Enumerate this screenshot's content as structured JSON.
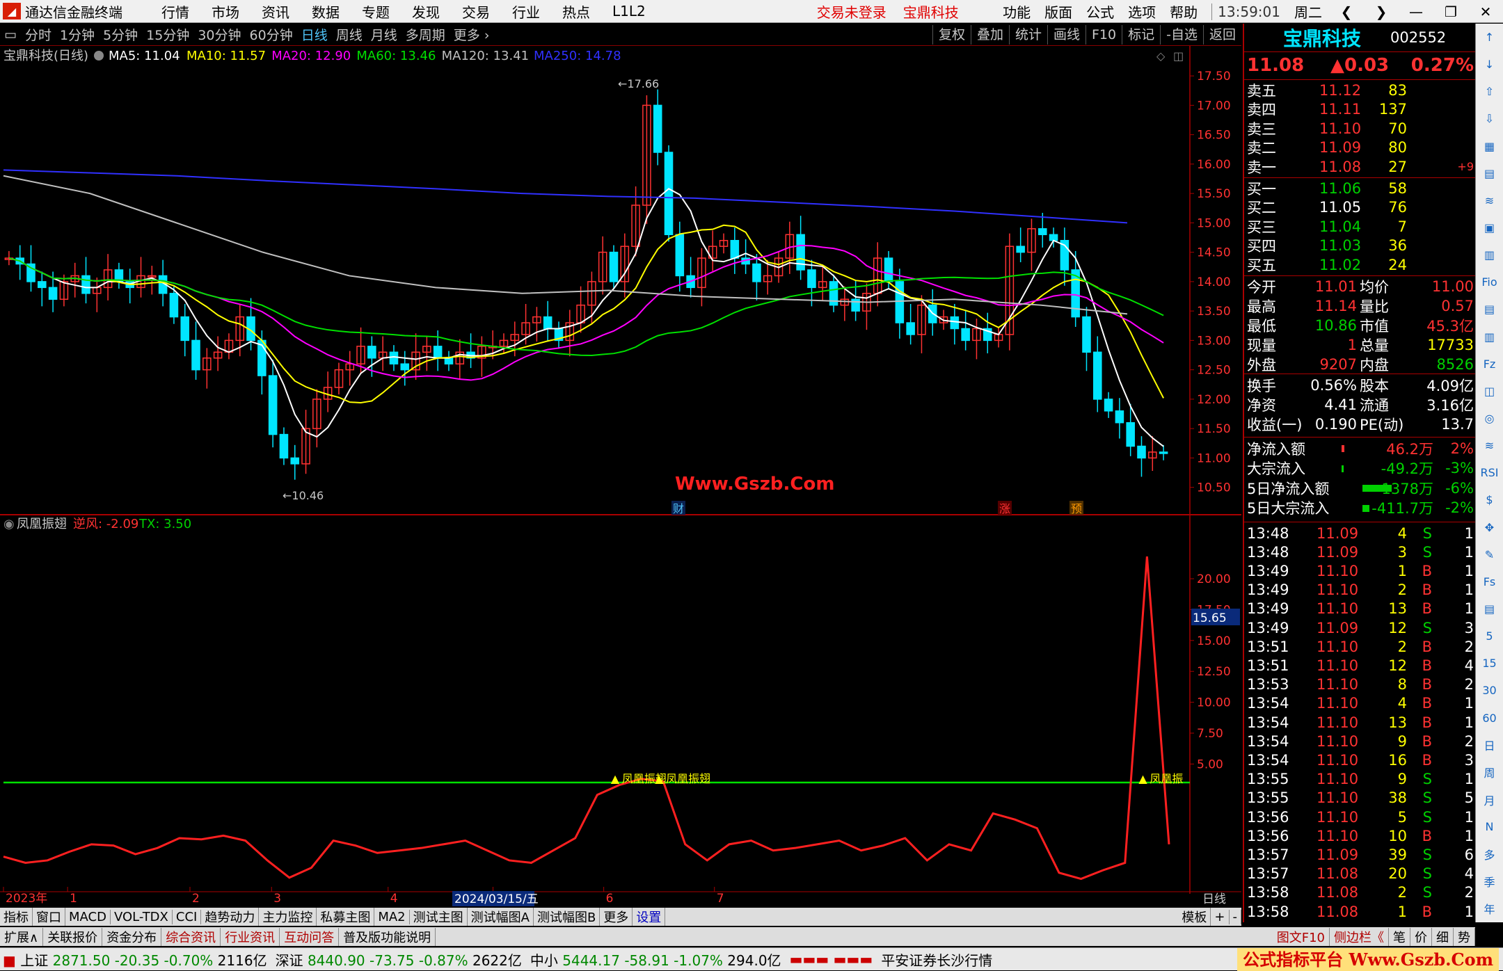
{
  "app": {
    "title": "通达信金融终端",
    "menu": [
      "行情",
      "市场",
      "资讯",
      "数据",
      "专题",
      "发现",
      "交易",
      "行业",
      "热点",
      "L1L2"
    ],
    "trade_status": "交易未登录",
    "stock_link": "宝鼎科技",
    "right_menu": [
      "功能",
      "版面",
      "公式",
      "选项",
      "帮助"
    ],
    "clock": "13:59:01",
    "weekday": "周二"
  },
  "periods": [
    "分时",
    "1分钟",
    "5分钟",
    "15分钟",
    "30分钟",
    "60分钟",
    "日线",
    "周线",
    "月线",
    "多周期",
    "更多"
  ],
  "active_period": "日线",
  "tools": [
    "复权",
    "叠加",
    "统计",
    "画线",
    "F10",
    "标记",
    "-自选",
    "返回"
  ],
  "main_chart": {
    "title": "宝鼎科技(日线)",
    "ma_labels": [
      {
        "text": "MA5: 11.04",
        "color": "#ffffff"
      },
      {
        "text": "MA10: 11.57",
        "color": "#ffff00"
      },
      {
        "text": "MA20: 12.90",
        "color": "#ff00ff"
      },
      {
        "text": "MA60: 13.46",
        "color": "#00e000"
      },
      {
        "text": "MA120: 13.41",
        "color": "#c0c0c0"
      },
      {
        "text": "MA250: 14.78",
        "color": "#3030ff"
      }
    ],
    "y_ticks": [
      "17.50",
      "17.00",
      "16.50",
      "16.00",
      "15.50",
      "15.00",
      "14.50",
      "14.00",
      "13.50",
      "13.00",
      "12.50",
      "12.00",
      "11.50",
      "11.00",
      "10.50"
    ],
    "y_range": [
      10.2,
      17.75
    ],
    "high_label": "17.66",
    "low_label": "10.46",
    "watermark": "Www.Gszb.Com",
    "event_markers": [
      {
        "text": "财",
        "color": "#4fc3f7"
      },
      {
        "text": "涨",
        "color": "#ff3232"
      },
      {
        "text": "预",
        "color": "#ff9800"
      }
    ]
  },
  "indicator": {
    "name": "凤凰振翅",
    "label1": "逆风: -2.09",
    "label2": "TX: 3.50",
    "y_ticks": [
      "20.00",
      "17.50",
      "15.00",
      "12.50",
      "10.00",
      "7.50",
      "5.00"
    ],
    "y_range": [
      -5,
      24
    ],
    "current": "15.65",
    "signal_labels": [
      "凤凰振翅",
      "凤凰振翅",
      "凤凰振"
    ],
    "threshold": 3.5
  },
  "x_axis": {
    "labels": [
      "2023年",
      "1",
      "2",
      "3",
      "4",
      "5",
      "6",
      "7"
    ],
    "cursor_date": "2024/03/15/五",
    "period": "日线"
  },
  "bottom_tabs": [
    "指标",
    "窗口",
    "MACD",
    "VOL-TDX",
    "CCI",
    "趋势动力",
    "主力监控",
    "私募主图",
    "MA2",
    "测试主图",
    "测试幅图A",
    "测试幅图B",
    "更多",
    "设置"
  ],
  "bottom_tabs_right": [
    "模板",
    "+",
    "-"
  ],
  "bottom_tabs2": [
    "扩展∧",
    "关联报价",
    "资金分布",
    "综合资讯",
    "行业资讯",
    "互动问答",
    "普及版功能说明"
  ],
  "bottom_tabs2_right": [
    "图文F10",
    "侧边栏《",
    "笔",
    "价",
    "细",
    "势"
  ],
  "status": {
    "indices": [
      {
        "name": "上证",
        "value": "2871.50",
        "chg": "-20.35",
        "pct": "-0.70%",
        "amt": "2116亿"
      },
      {
        "name": "深证",
        "value": "8440.90",
        "chg": "-73.75",
        "pct": "-0.87%",
        "amt": "2622亿"
      },
      {
        "name": "中小",
        "value": "5444.17",
        "chg": "-58.91",
        "pct": "-1.07%",
        "amt": "294.0亿"
      }
    ],
    "broker": "平安证券长沙行情",
    "brand": "公式指标平台 Www.Gszb.Com"
  },
  "quote": {
    "name": "宝鼎科技",
    "code": "002552",
    "price": "11.08",
    "change": "▲0.03",
    "pct": "0.27%",
    "asks": [
      {
        "label": "卖五",
        "price": "11.12",
        "vol": "83"
      },
      {
        "label": "卖四",
        "price": "11.11",
        "vol": "137"
      },
      {
        "label": "卖三",
        "price": "11.10",
        "vol": "70"
      },
      {
        "label": "卖二",
        "price": "11.09",
        "vol": "80"
      },
      {
        "label": "卖一",
        "price": "11.08",
        "vol": "27",
        "extra": "+9"
      }
    ],
    "bids": [
      {
        "label": "买一",
        "price": "11.06",
        "vol": "58"
      },
      {
        "label": "买二",
        "price": "11.05",
        "vol": "76"
      },
      {
        "label": "买三",
        "price": "11.04",
        "vol": "7"
      },
      {
        "label": "买四",
        "price": "11.03",
        "vol": "36"
      },
      {
        "label": "买五",
        "price": "11.02",
        "vol": "24"
      }
    ],
    "stats": [
      {
        "k1": "今开",
        "v1": "11.01",
        "k2": "均价",
        "v2": "11.00"
      },
      {
        "k1": "最高",
        "v1": "11.14",
        "k2": "量比",
        "v2": "0.57"
      },
      {
        "k1": "最低",
        "v1": "10.86",
        "k2": "市值",
        "v2": "45.3亿"
      },
      {
        "k1": "现量",
        "v1": "1",
        "k2": "总量",
        "v2": "17733"
      },
      {
        "k1": "外盘",
        "v1": "9207",
        "k2": "内盘",
        "v2": "8526"
      }
    ],
    "stats2": [
      {
        "k1": "换手",
        "v1": "0.56%",
        "k2": "股本",
        "v2": "4.09亿"
      },
      {
        "k1": "净资",
        "v1": "4.41",
        "k2": "流通",
        "v2": "3.16亿"
      },
      {
        "k1": "收益(一)",
        "v1": "0.190",
        "k2": "PE(动)",
        "v2": "13.7"
      }
    ],
    "flows": [
      {
        "k": "净流入额",
        "v": "46.2万",
        "p": "2%",
        "bar": 2
      },
      {
        "k": "大宗流入",
        "v": "-49.2万",
        "p": "-3%",
        "bar": 1
      },
      {
        "k": "5日净流入额",
        "v": "-1378万",
        "p": "-6%",
        "bar": 50
      },
      {
        "k": "5日大宗流入",
        "v": "-411.7万",
        "p": "-2%",
        "bar": 10
      }
    ],
    "ticks": [
      {
        "t": "13:48",
        "p": "11.09",
        "v": "4",
        "s": "S",
        "n": "1"
      },
      {
        "t": "13:48",
        "p": "11.09",
        "v": "3",
        "s": "S",
        "n": "1"
      },
      {
        "t": "13:49",
        "p": "11.10",
        "v": "1",
        "s": "B",
        "n": "1"
      },
      {
        "t": "13:49",
        "p": "11.10",
        "v": "2",
        "s": "B",
        "n": "1"
      },
      {
        "t": "13:49",
        "p": "11.10",
        "v": "13",
        "s": "B",
        "n": "1"
      },
      {
        "t": "13:49",
        "p": "11.09",
        "v": "12",
        "s": "S",
        "n": "3"
      },
      {
        "t": "13:51",
        "p": "11.10",
        "v": "2",
        "s": "B",
        "n": "2"
      },
      {
        "t": "13:51",
        "p": "11.10",
        "v": "12",
        "s": "B",
        "n": "4"
      },
      {
        "t": "13:53",
        "p": "11.10",
        "v": "8",
        "s": "B",
        "n": "2"
      },
      {
        "t": "13:54",
        "p": "11.10",
        "v": "4",
        "s": "B",
        "n": "1"
      },
      {
        "t": "13:54",
        "p": "11.10",
        "v": "13",
        "s": "B",
        "n": "1"
      },
      {
        "t": "13:54",
        "p": "11.10",
        "v": "9",
        "s": "B",
        "n": "2"
      },
      {
        "t": "13:54",
        "p": "11.10",
        "v": "16",
        "s": "B",
        "n": "3"
      },
      {
        "t": "13:55",
        "p": "11.10",
        "v": "9",
        "s": "S",
        "n": "1"
      },
      {
        "t": "13:55",
        "p": "11.10",
        "v": "38",
        "s": "S",
        "n": "5"
      },
      {
        "t": "13:56",
        "p": "11.10",
        "v": "5",
        "s": "S",
        "n": "1"
      },
      {
        "t": "13:56",
        "p": "11.10",
        "v": "10",
        "s": "B",
        "n": "1"
      },
      {
        "t": "13:57",
        "p": "11.09",
        "v": "39",
        "s": "S",
        "n": "6"
      },
      {
        "t": "13:57",
        "p": "11.08",
        "v": "20",
        "s": "S",
        "n": "4"
      },
      {
        "t": "13:58",
        "p": "11.08",
        "v": "2",
        "s": "S",
        "n": "2"
      },
      {
        "t": "13:58",
        "p": "11.08",
        "v": "1",
        "s": "B",
        "n": "1"
      }
    ]
  },
  "sidebar": [
    "↑",
    "↓",
    "⇧",
    "⇩",
    "▦",
    "▤",
    "≋",
    "▣",
    "▥",
    "Fio",
    "▤",
    "▥",
    "Fz",
    "◫",
    "◎",
    "≋",
    "RSI",
    "$",
    "✥",
    "✎",
    "Fs",
    "▤",
    "5",
    "15",
    "30",
    "60",
    "日",
    "周",
    "月",
    "N",
    "多",
    "季",
    "年"
  ],
  "chart_data": {
    "type": "candlestick",
    "price_series": [
      14.4,
      14.3,
      14.0,
      13.9,
      13.7,
      14.0,
      14.1,
      13.8,
      13.9,
      14.2,
      14.0,
      13.9,
      14.1,
      14.1,
      13.8,
      13.4,
      13.0,
      12.5,
      12.7,
      12.8,
      13.0,
      13.4,
      13.0,
      12.4,
      11.4,
      11.0,
      10.9,
      11.5,
      12.0,
      12.2,
      12.5,
      12.6,
      12.9,
      12.7,
      12.8,
      12.6,
      12.5,
      12.8,
      12.9,
      12.7,
      12.6,
      12.8,
      12.7,
      12.9,
      12.9,
      13.0,
      13.1,
      13.3,
      13.4,
      13.2,
      13.0,
      13.3,
      13.6,
      14.0,
      14.5,
      14.0,
      14.6,
      15.3,
      17.0,
      16.2,
      14.8,
      14.1,
      13.9,
      14.4,
      14.6,
      14.7,
      14.4,
      14.3,
      14.0,
      14.1,
      14.4,
      14.8,
      14.2,
      13.9,
      14.0,
      13.6,
      13.7,
      13.5,
      13.8,
      14.4,
      14.0,
      13.3,
      13.1,
      13.6,
      13.3,
      13.4,
      13.2,
      13.0,
      13.2,
      13.0,
      13.1,
      14.6,
      14.5,
      14.9,
      14.8,
      14.7,
      14.2,
      13.4,
      12.8,
      12.0,
      11.8,
      11.6,
      11.2,
      11.0,
      11.1,
      11.08
    ],
    "ma_series": [
      {
        "name": "MA250",
        "color": "#3030ff",
        "values": [
          15.9,
          15.85,
          15.8,
          15.72,
          15.65,
          15.58,
          15.5,
          15.45,
          15.42,
          15.35,
          15.28,
          15.2,
          15.1,
          15.0
        ]
      },
      {
        "name": "MA120",
        "color": "#c0c0c0",
        "values": [
          15.8,
          15.5,
          15.0,
          14.5,
          14.1,
          13.9,
          13.8,
          13.85,
          13.75,
          13.7,
          13.65,
          13.7,
          13.6,
          13.45
        ]
      }
    ],
    "indicator_series": [
      -2.5,
      -3,
      -2.8,
      -2.1,
      -1.5,
      -1.6,
      -2.3,
      -1.8,
      -1.0,
      -1.1,
      -0.8,
      -1.2,
      -2.8,
      -4.2,
      -3.4,
      -1.2,
      -1.6,
      -2.2,
      -2.0,
      -1.8,
      -1.5,
      -1.2,
      -2.0,
      -2.8,
      -3.0,
      -2.0,
      -1.0,
      2.5,
      3.3,
      3.8,
      3.6,
      -1.5,
      -2.8,
      -1.5,
      -1.2,
      -2.0,
      -1.8,
      -1.5,
      -1.2,
      -2.0,
      -1.6,
      -1.0,
      -2.8,
      -1.5,
      -2.0,
      1.0,
      0.5,
      -0.2,
      -3.8,
      -4.3,
      -3.6,
      -3.0,
      21.8,
      -1.5
    ]
  }
}
